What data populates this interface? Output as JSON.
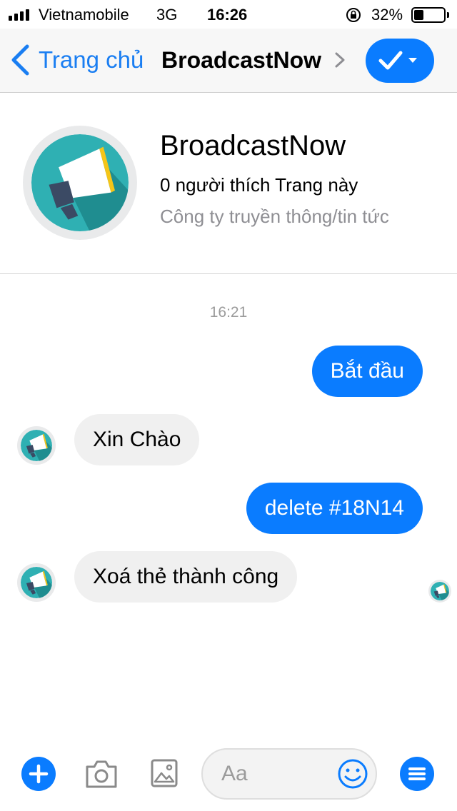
{
  "status_bar": {
    "carrier": "Vietnamobile",
    "network": "3G",
    "time": "16:26",
    "battery_percent": "32%",
    "battery_level": 0.32
  },
  "nav": {
    "back_label": "Trang chủ",
    "title": "BroadcastNow",
    "accent_color": "#0a7cff"
  },
  "page": {
    "name": "BroadcastNow",
    "likes": "0 người thích Trang này",
    "category": "Công ty truyền thông/tin tức"
  },
  "conversation": {
    "timestamp": "16:21",
    "messages": [
      {
        "direction": "outgoing",
        "text": "Bắt đầu"
      },
      {
        "direction": "incoming",
        "text": "Xin Chào"
      },
      {
        "direction": "outgoing",
        "text": "delete #18N14"
      },
      {
        "direction": "incoming",
        "text": "Xoá thẻ thành công"
      }
    ]
  },
  "composer": {
    "placeholder": "Aa",
    "icons": [
      "plus-icon",
      "camera-icon",
      "image-icon",
      "emoji-icon",
      "menu-icon"
    ]
  }
}
